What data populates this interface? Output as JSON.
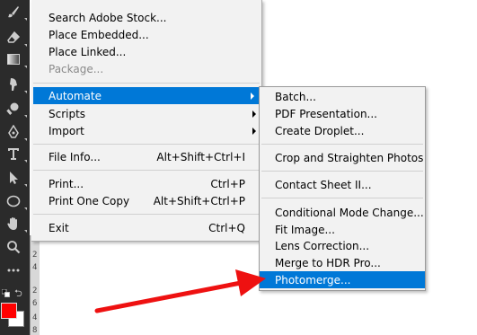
{
  "file_menu": {
    "items": [
      {
        "label": "Search Adobe Stock...",
        "shortcut": ""
      },
      {
        "label": "Place Embedded...",
        "shortcut": ""
      },
      {
        "label": "Place Linked...",
        "shortcut": ""
      },
      {
        "label": "Package...",
        "shortcut": "",
        "disabled": true
      },
      {
        "label": "Automate",
        "shortcut": "",
        "submenu": true,
        "highlighted": true
      },
      {
        "label": "Scripts",
        "shortcut": "",
        "submenu": true
      },
      {
        "label": "Import",
        "shortcut": "",
        "submenu": true
      },
      {
        "label": "File Info...",
        "shortcut": "Alt+Shift+Ctrl+I"
      },
      {
        "label": "Print...",
        "shortcut": "Ctrl+P"
      },
      {
        "label": "Print One Copy",
        "shortcut": "Alt+Shift+Ctrl+P"
      },
      {
        "label": "Exit",
        "shortcut": "Ctrl+Q"
      }
    ]
  },
  "automate_submenu": {
    "items": [
      {
        "label": "Batch..."
      },
      {
        "label": "PDF Presentation..."
      },
      {
        "label": "Create Droplet..."
      },
      {
        "label": "Crop and Straighten Photos"
      },
      {
        "label": "Contact Sheet II..."
      },
      {
        "label": "Conditional Mode Change..."
      },
      {
        "label": "Fit Image..."
      },
      {
        "label": "Lens Correction..."
      },
      {
        "label": "Merge to HDR Pro..."
      },
      {
        "label": "Photomerge...",
        "highlighted": true
      }
    ]
  },
  "toolbar": {
    "tools": [
      "brush-icon",
      "eraser-icon",
      "gradient-icon",
      "smudge-icon",
      "dodge-icon",
      "pen-icon",
      "type-icon",
      "path-selection-icon",
      "ellipse-icon",
      "hand-icon",
      "zoom-icon",
      "more-tools-icon"
    ],
    "foreground_color": "#ff0000",
    "background_color": "#ffffff"
  },
  "ruler": {
    "numbers": [
      "2",
      "4",
      "2",
      "6",
      "4",
      "8"
    ]
  },
  "colors": {
    "highlight": "#0078d7",
    "menu_bg": "#f2f2f2",
    "toolbar_bg": "#2b2b2b",
    "annotation_arrow": "#ee1111"
  }
}
